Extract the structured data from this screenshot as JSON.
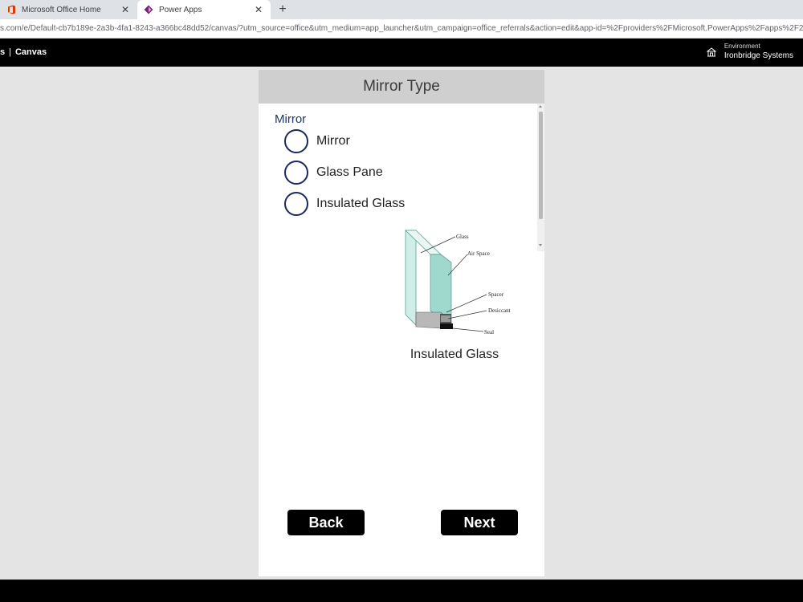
{
  "browser": {
    "tabs": [
      {
        "title": "Microsoft Office Home",
        "icon": "office-icon",
        "active": false
      },
      {
        "title": "Power Apps",
        "icon": "powerapps-icon",
        "active": true
      }
    ],
    "close_glyph": "✕",
    "new_tab_glyph": "+",
    "url": "s.com/e/Default-cb7b189e-2a3b-4fa1-8243-a366bc48dd52/canvas/?utm_source=office&utm_medium=app_launcher&utm_campaign=office_referrals&action=edit&app-id=%2Fproviders%2FMicrosoft.PowerApps%2Fapps%2F2c78d25"
  },
  "app_header": {
    "crumb_left": "s",
    "separator": "|",
    "crumb_canvas": "Canvas",
    "environment_label": "Environment",
    "environment_name": "Ironbridge Systems"
  },
  "screen": {
    "title": "Mirror Type",
    "group_label": "Mirror",
    "options": [
      {
        "label": "Mirror",
        "selected": false
      },
      {
        "label": "Glass Pane",
        "selected": false
      },
      {
        "label": "Insulated Glass",
        "selected": false
      }
    ],
    "diagram_labels": {
      "glass": "Glass",
      "air_space": "Air Space",
      "spacer": "Spacer",
      "desiccant": "Desiccant",
      "seal": "Seal"
    },
    "image_caption": "Insulated Glass",
    "back_label": "Back",
    "next_label": "Next"
  },
  "colors": {
    "header_bar": "#000000",
    "screen_header": "#cfcfcf",
    "radio_border": "#1a2a5c",
    "group_label": "#1f3864",
    "glass": "#8fd3c6",
    "background": "#e4e4e4"
  }
}
